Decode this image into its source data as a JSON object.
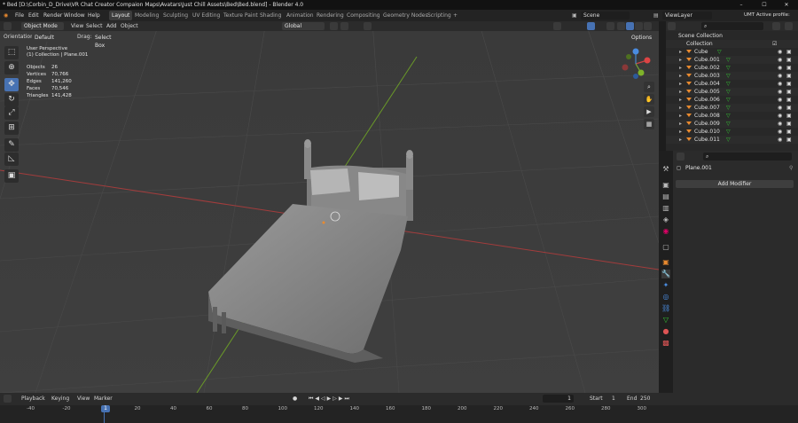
{
  "window": {
    "title": "* Bed [D:\\Corbin_D_Drive\\VR Chat Creator Compaion Maps\\Avatars\\Just Chill Assets\\Bed\\Bed.blend] - Blender 4.0",
    "controls": [
      "–",
      "☐",
      "✕"
    ]
  },
  "menu": [
    "File",
    "Edit",
    "Render",
    "Window",
    "Help"
  ],
  "workspaces": [
    "Layout",
    "Modeling",
    "Sculpting",
    "UV Editing",
    "Texture Paint",
    "Shading",
    "Animation",
    "Rendering",
    "Compositing",
    "Geometry Nodes",
    "Scripting",
    "+"
  ],
  "scene": "Scene",
  "view_layer": "ViewLayer",
  "profile": "UMT Active profile: FNAF Sb",
  "viewport_header": {
    "mode": "Object Mode",
    "menus": [
      "View",
      "Select",
      "Add",
      "Object"
    ],
    "transform": "Global",
    "options": "Options"
  },
  "viewport_header2": {
    "orientation_label": "Orientation:",
    "orientation": "Default",
    "drag_label": "Drag:",
    "drag": "Select Box"
  },
  "overlay_text": {
    "view": "User Perspective",
    "context": "(1) Collection | Plane.001"
  },
  "stats": [
    {
      "label": "Objects",
      "value": "26"
    },
    {
      "label": "Vertices",
      "value": "70,766"
    },
    {
      "label": "Edges",
      "value": "141,260"
    },
    {
      "label": "Faces",
      "value": "70,546"
    },
    {
      "label": "Triangles",
      "value": "141,428"
    }
  ],
  "outliner": {
    "root": "Scene Collection",
    "collection": "Collection",
    "items": [
      "Cube",
      "Cube.001",
      "Cube.002",
      "Cube.003",
      "Cube.004",
      "Cube.005",
      "Cube.006",
      "Cube.007",
      "Cube.008",
      "Cube.009",
      "Cube.010",
      "Cube.011"
    ]
  },
  "properties": {
    "object_name": "Plane.001",
    "add_modifier": "Add Modifier"
  },
  "timeline": {
    "menus": [
      "Playback",
      "Keying",
      "View",
      "Marker"
    ],
    "current_frame": "1",
    "start_label": "Start",
    "start": "1",
    "end_label": "End",
    "end": "250",
    "ticks": [
      "-40",
      "-20",
      "0",
      "20",
      "40",
      "60",
      "80",
      "100",
      "120",
      "140",
      "160",
      "180",
      "200",
      "220",
      "240",
      "260",
      "280",
      "300"
    ],
    "playhead": "1"
  },
  "colors": {
    "accent": "#4772b3",
    "x_axis": "#b53d3d",
    "y_axis": "#6f9a2a",
    "object_orange": "#e98a2f"
  }
}
